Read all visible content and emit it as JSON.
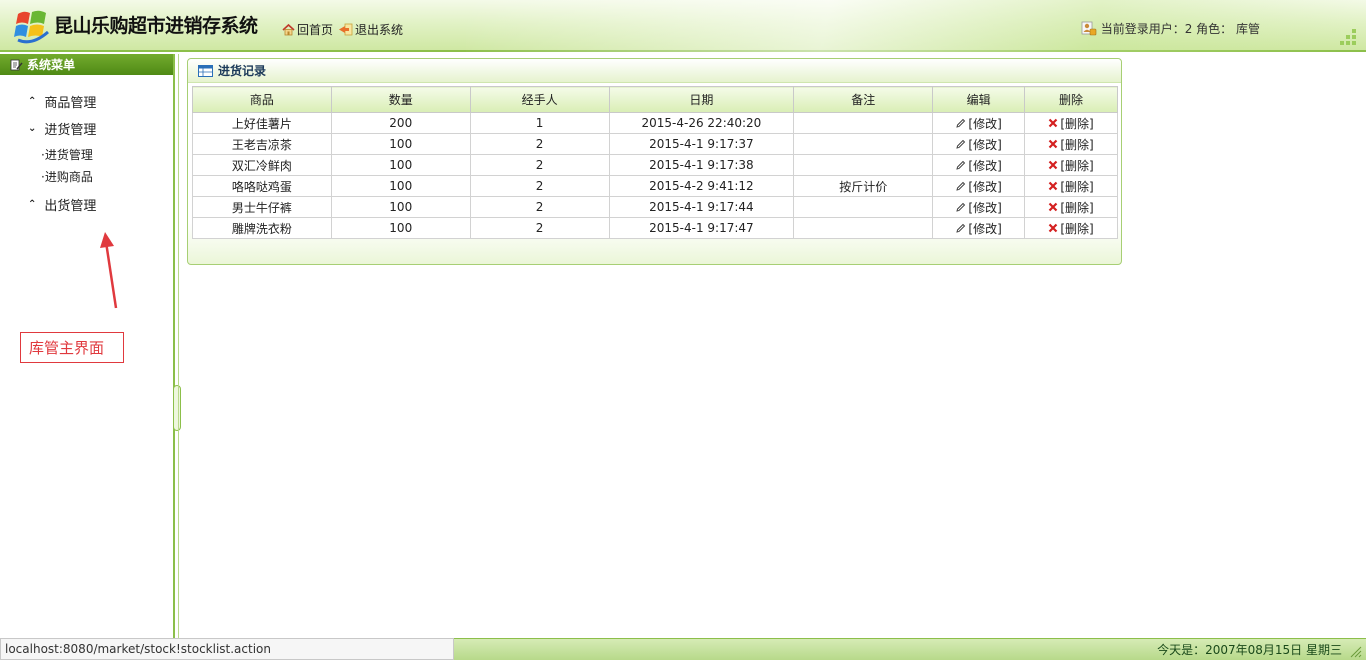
{
  "header": {
    "title": "昆山乐购超市进销存系统",
    "home_link": "回首页",
    "logout_link": "退出系统",
    "user_info": "当前登录用户：2 角色： 库管"
  },
  "sidebar": {
    "title": "系统菜单",
    "items": [
      {
        "label": "商品管理",
        "state": "collapsed"
      },
      {
        "label": "进货管理",
        "state": "expanded"
      },
      {
        "label": "出货管理",
        "state": "collapsed"
      }
    ],
    "sub_items": [
      {
        "label": "·进货管理"
      },
      {
        "label": "·进购商品"
      }
    ]
  },
  "annotation": {
    "label": "库管主界面",
    "color": "#e0393e"
  },
  "panel": {
    "title": "进货记录",
    "columns": [
      "商品",
      "数量",
      "经手人",
      "日期",
      "备注",
      "编辑",
      "删除"
    ],
    "edit_label": "[修改]",
    "delete_label": "[删除]",
    "rows": [
      {
        "product": "上好佳薯片",
        "qty": "200",
        "handler": "1",
        "date": "2015-4-26 22:40:20",
        "note": ""
      },
      {
        "product": "王老吉凉茶",
        "qty": "100",
        "handler": "2",
        "date": "2015-4-1 9:17:37",
        "note": ""
      },
      {
        "product": "双汇冷鲜肉",
        "qty": "100",
        "handler": "2",
        "date": "2015-4-1 9:17:38",
        "note": ""
      },
      {
        "product": "咯咯哒鸡蛋",
        "qty": "100",
        "handler": "2",
        "date": "2015-4-2 9:41:12",
        "note": "按斤计价"
      },
      {
        "product": "男士牛仔裤",
        "qty": "100",
        "handler": "2",
        "date": "2015-4-1 9:17:44",
        "note": ""
      },
      {
        "product": "雕牌洗衣粉",
        "qty": "100",
        "handler": "2",
        "date": "2015-4-1 9:17:47",
        "note": ""
      }
    ]
  },
  "statusbar": {
    "url": "localhost:8080/market/stock!stocklist.action",
    "date": "今天是：2007年08月15日 星期三"
  },
  "colors": {
    "accent_green": "#8cbf4a",
    "sidebar_head": "#5a9420",
    "delete_red": "#d42020"
  }
}
